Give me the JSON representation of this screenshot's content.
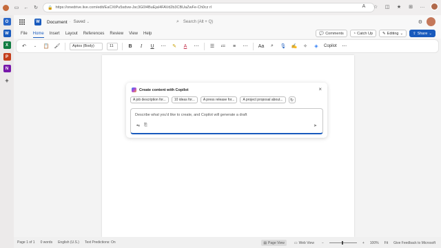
{
  "browser": {
    "url": "https://onedrive.live.com/edit/EaCXtPu5sdvw-Jsc3G0I4BuEjaI4FAVd2b3CBUaZwFe-Ch0cz rl"
  },
  "title_bar": {
    "doc_name": "Document",
    "saved_status": "Saved",
    "search_placeholder": "Search (Alt + Q)"
  },
  "menu": {
    "tabs": [
      "File",
      "Home",
      "Insert",
      "Layout",
      "References",
      "Review",
      "View",
      "Help"
    ],
    "active_tab": "Home",
    "comments_label": "Comments",
    "catchup_label": "Catch Up",
    "editing_label": "Editing",
    "share_label": "Share"
  },
  "ribbon": {
    "font_name": "Aptos (Body)",
    "font_size": "11",
    "copilot_label": "Copilot"
  },
  "copilot_dialog": {
    "title": "Create content with Copilot",
    "chips": [
      "A job description for...",
      "10 ideas for...",
      "A press release for...",
      "A project proposal about..."
    ],
    "prompt_placeholder": "Describe what you'd like to create, and Copilot will generate a draft"
  },
  "status_bar": {
    "page": "Page 1 of 1",
    "words": "0 words",
    "language": "English (U.S.)",
    "predictions": "Text Predictions: On",
    "page_view": "Page View",
    "web_view": "Web View",
    "zoom": "100%",
    "fit": "Fit",
    "feedback": "Give Feedback to Microsoft"
  },
  "colors": {
    "word_blue": "#185abd",
    "accent_red": "#c4314b"
  }
}
